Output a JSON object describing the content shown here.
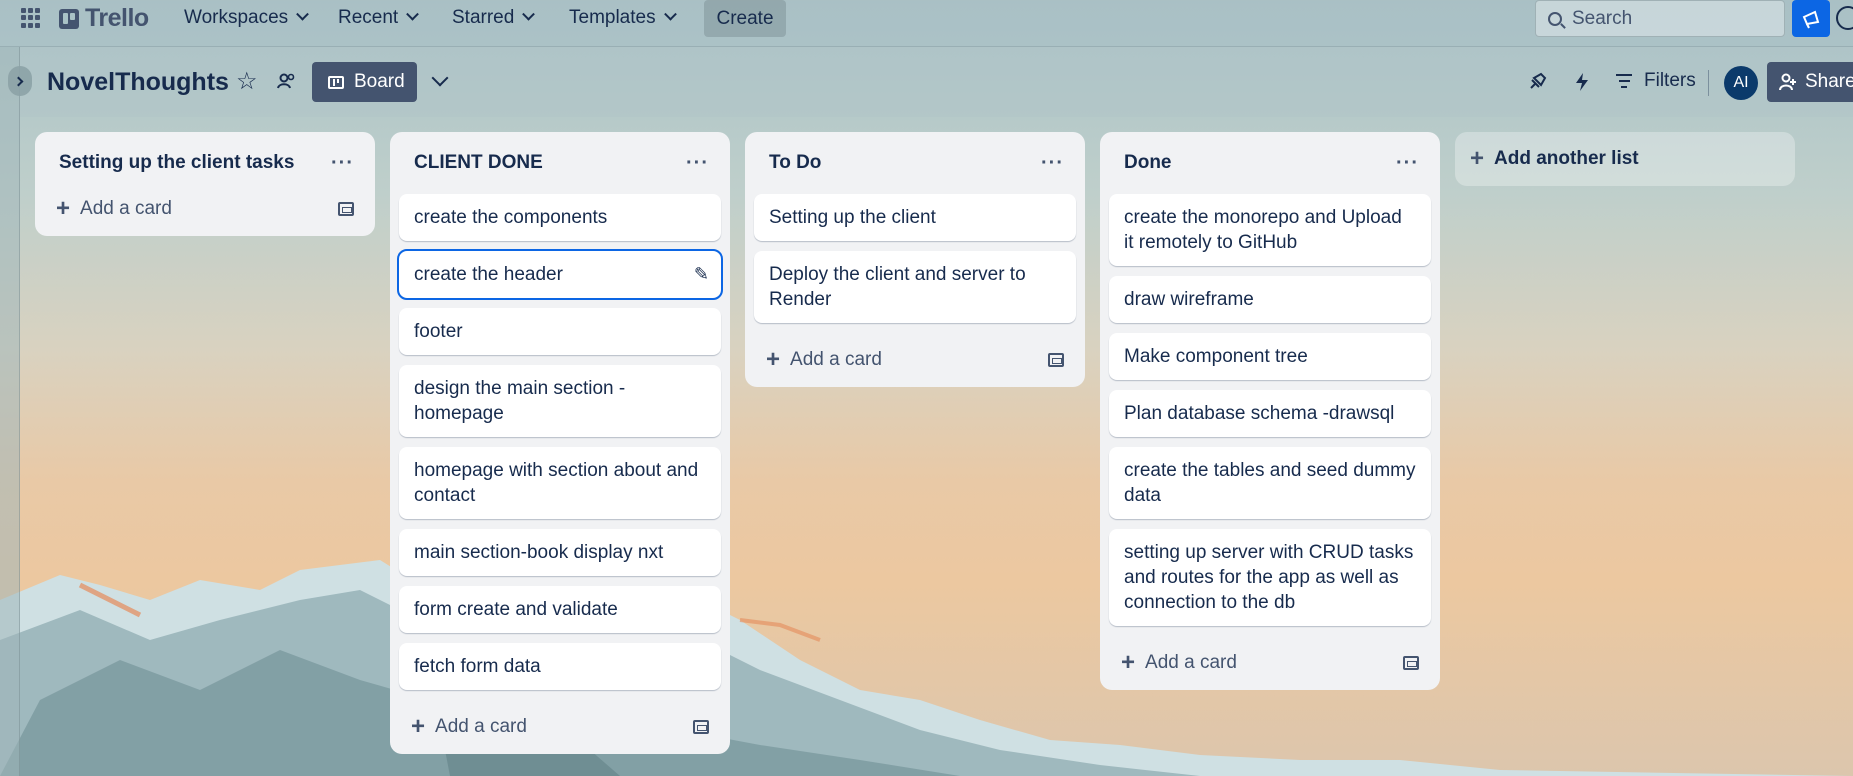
{
  "topbar": {
    "logo_text": "Trello",
    "nav": [
      {
        "label": "Workspaces"
      },
      {
        "label": "Recent"
      },
      {
        "label": "Starred"
      },
      {
        "label": "Templates"
      }
    ],
    "create_label": "Create",
    "search_placeholder": "Search"
  },
  "board": {
    "title": "NovelThoughts",
    "view_label": "Board",
    "filters_label": "Filters",
    "avatar_initials": "AI",
    "share_label": "Share"
  },
  "lists": [
    {
      "title": "Setting up the client tasks",
      "cards": [],
      "add_label": "Add a card"
    },
    {
      "title": "CLIENT DONE",
      "cards": [
        "create the components",
        "create the header",
        "footer",
        "design the main section - homepage",
        "homepage with section about and contact",
        "main section-book display nxt",
        "form create and validate",
        "fetch form data"
      ],
      "add_label": "Add a card"
    },
    {
      "title": "To Do",
      "cards": [
        "Setting up the client",
        "Deploy the client and server to Render"
      ],
      "add_label": "Add a card"
    },
    {
      "title": "Done",
      "cards": [
        "create the monorepo and Upload it remotely to GitHub",
        "draw wireframe",
        "Make component tree",
        "Plan database schema -drawsql",
        "create the tables and seed dummy data",
        "setting up server with CRUD tasks and routes for the app as well as connection to the db"
      ],
      "add_label": "Add a card"
    }
  ],
  "add_list_label": "Add another list",
  "colors": {
    "accent": "#0c66e4",
    "header_button": "#44546f",
    "list_bg": "#f1f2f4",
    "text": "#172b4d"
  }
}
